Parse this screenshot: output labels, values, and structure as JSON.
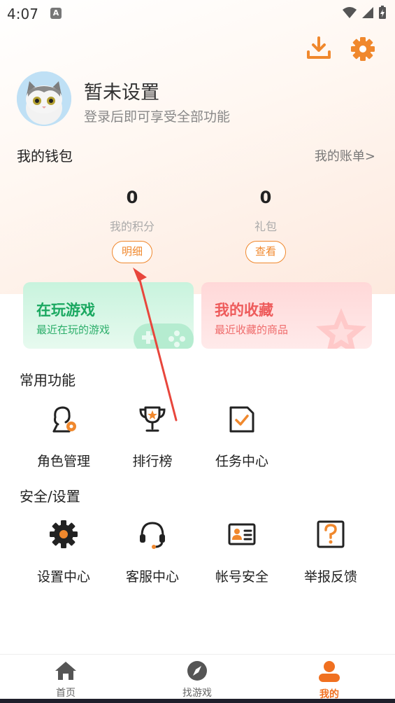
{
  "status_bar": {
    "time": "4:07",
    "notif_letter": "A"
  },
  "header": {
    "download_icon": "download-icon",
    "settings_icon": "gear-icon"
  },
  "profile": {
    "name": "暂未设置",
    "subtitle": "登录后即可享受全部功能"
  },
  "wallet": {
    "title": "我的钱包",
    "bill_link": "我的账单>",
    "points": {
      "value": "0",
      "label": "我的积分",
      "button": "明细"
    },
    "gifts": {
      "value": "0",
      "label": "礼包",
      "button": "查看"
    }
  },
  "cards": {
    "playing": {
      "title": "在玩游戏",
      "subtitle": "最近在玩的游戏"
    },
    "favorites": {
      "title": "我的收藏",
      "subtitle": "最近收藏的商品"
    }
  },
  "common": {
    "title": "常用功能",
    "items": [
      {
        "label": "角色管理",
        "icon": "role-manage-icon"
      },
      {
        "label": "排行榜",
        "icon": "trophy-icon"
      },
      {
        "label": "任务中心",
        "icon": "task-icon"
      }
    ]
  },
  "security": {
    "title": "安全/设置",
    "items": [
      {
        "label": "设置中心",
        "icon": "gear-icon"
      },
      {
        "label": "客服中心",
        "icon": "headset-icon"
      },
      {
        "label": "帐号安全",
        "icon": "id-card-icon"
      },
      {
        "label": "举报反馈",
        "icon": "question-icon"
      }
    ]
  },
  "nav": [
    {
      "label": "首页",
      "icon": "home-icon",
      "active": false
    },
    {
      "label": "找游戏",
      "icon": "compass-icon",
      "active": false
    },
    {
      "label": "我的",
      "icon": "user-icon",
      "active": true
    }
  ],
  "colors": {
    "accent": "#f0882d",
    "green": "#1aa860",
    "red": "#ee5b5b",
    "active_nav": "#f07020"
  }
}
